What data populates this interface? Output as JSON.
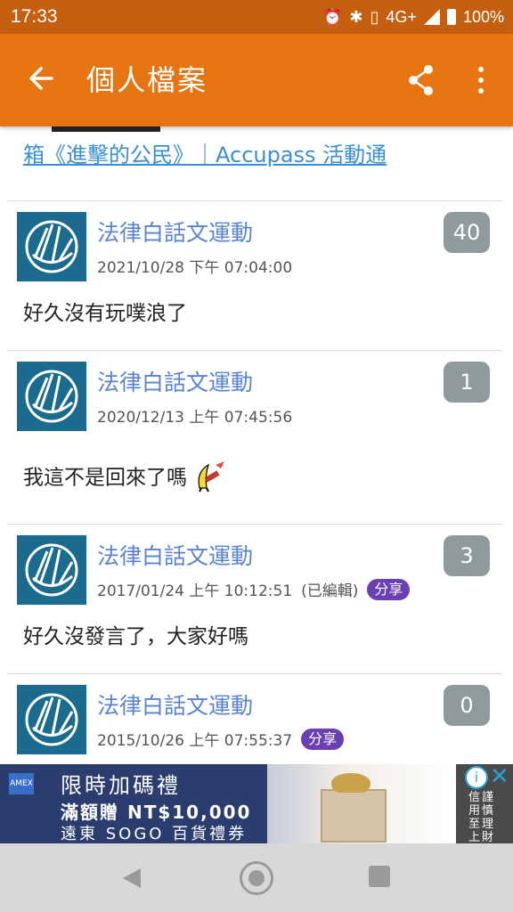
{
  "status_bar": {
    "time": "17:33",
    "network": "4G+",
    "battery": "100%"
  },
  "app_bar": {
    "title": "個人檔案",
    "back_icon": "arrow-left-icon",
    "share_icon": "share-icon",
    "more_icon": "more-vertical-icon",
    "color": "#e67511"
  },
  "previous_link": {
    "text": "箱《進擊的公民》｜Accupass 活動通"
  },
  "posts": [
    {
      "author": "法律白話文運動",
      "timestamp": "2021/10/28 下午 07:04:00",
      "edited": "",
      "share": "",
      "count": "40",
      "text": "好久沒有玩噗浪了"
    },
    {
      "author": "法律白話文運動",
      "timestamp": "2020/12/13 上午 07:45:56",
      "edited": "",
      "share": "",
      "count": "1",
      "text": "我這不是回來了嗎"
    },
    {
      "author": "法律白話文運動",
      "timestamp": "2017/01/24 上午 10:12:51",
      "edited": "(已編輯)",
      "share": "分享",
      "count": "3",
      "text": "好久沒發言了，大家好嗎"
    },
    {
      "author": "法律白話文運動",
      "timestamp": "2015/10/26 上午 07:55:37",
      "edited": "",
      "share": "分享",
      "count": "0",
      "text": ""
    }
  ],
  "ad": {
    "logo_text": "AMEX",
    "line1": "限時加碼禮",
    "line2": "滿額贈 NT$10,000",
    "line3": "遠東 SOGO 百貨禮券",
    "side_text": "信謹用慎至理上財",
    "info_icon": "info-icon",
    "close_icon": "close-icon"
  },
  "nav_bar": {
    "back_icon": "nav-back-icon",
    "home_icon": "nav-home-icon",
    "recents_icon": "nav-recents-icon"
  }
}
